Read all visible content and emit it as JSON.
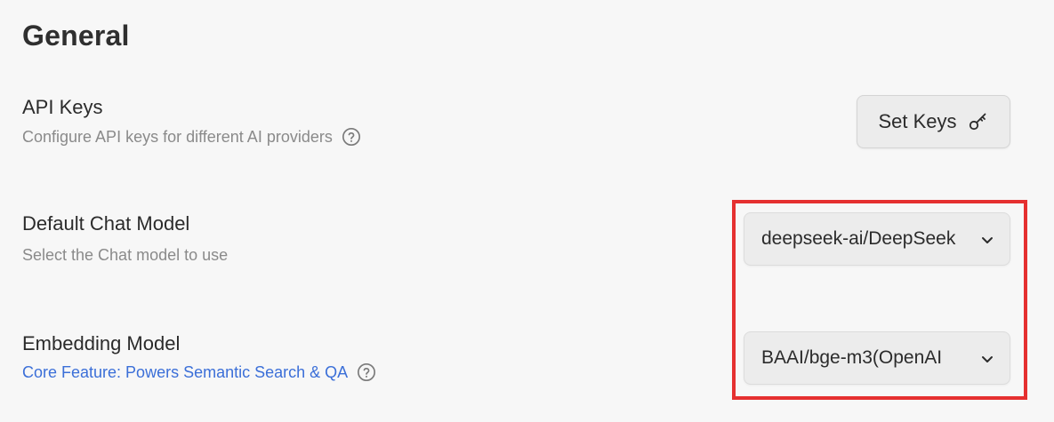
{
  "page": {
    "title": "General"
  },
  "api_keys": {
    "title": "API Keys",
    "description": "Configure API keys for different AI providers",
    "button_label": "Set Keys",
    "button_icon": "key-icon",
    "help_icon": "question-circle-icon"
  },
  "chat_model": {
    "title": "Default Chat Model",
    "description": "Select the Chat model to use",
    "selected": "deepseek-ai/DeepSeek",
    "dropdown_icon": "chevron-down-icon"
  },
  "embedding_model": {
    "title": "Embedding Model",
    "description": "Core Feature: Powers Semantic Search & QA",
    "description_color": "#3b6fd8",
    "selected": "BAAI/bge-m3(OpenAI",
    "dropdown_icon": "chevron-down-icon",
    "help_icon": "question-circle-icon"
  },
  "annotation": {
    "highlight_color": "#e53030"
  }
}
